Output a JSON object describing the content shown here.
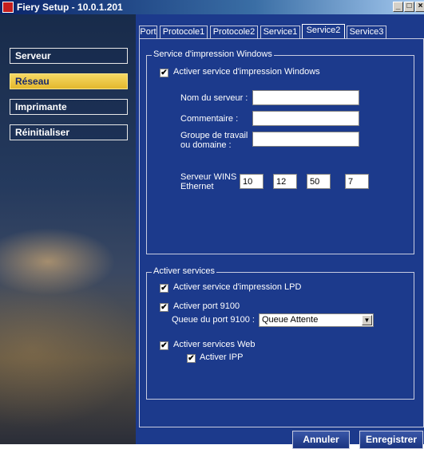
{
  "window": {
    "title": "Fiery Setup - 10.0.1.201"
  },
  "sidebar": {
    "items": [
      {
        "label": "Serveur"
      },
      {
        "label": "Réseau"
      },
      {
        "label": "Imprimante"
      },
      {
        "label": "Réinitialiser"
      }
    ],
    "selected": "Réseau"
  },
  "tabs": [
    {
      "label": "Port"
    },
    {
      "label": "Protocole1"
    },
    {
      "label": "Protocole2"
    },
    {
      "label": "Service1"
    },
    {
      "label": "Service2"
    },
    {
      "label": "Service3"
    }
  ],
  "active_tab": "Service2",
  "windows_group": {
    "legend": "Service d'impression Windows",
    "enable_label": "Activer service d'impression Windows",
    "server_name_label": "Nom du serveur :",
    "server_name_value": "",
    "comment_label": "Commentaire :",
    "comment_value": "",
    "workgroup_label_line1": "Groupe de travail",
    "workgroup_label_line2": "ou domaine :",
    "workgroup_value": "",
    "wins_label_line1": "Serveur WINS",
    "wins_label_line2": "Ethernet",
    "wins_octets": [
      "10",
      "12",
      "50",
      "7"
    ]
  },
  "services_group": {
    "legend": "Activer services",
    "lpd_label": "Activer service d'impression LPD",
    "port9100_label": "Activer port 9100",
    "queue_label": "Queue du port 9100 :",
    "queue_value": "Queue Attente",
    "web_label": "Activer services Web",
    "ipp_label": "Activer IPP"
  },
  "buttons": {
    "cancel": "Annuler",
    "save": "Enregistrer"
  },
  "check_glyph": "✔"
}
